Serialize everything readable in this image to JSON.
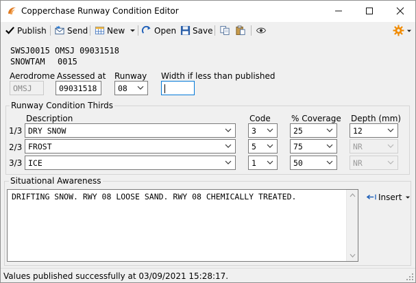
{
  "window": {
    "title": "Copperchase Runway Condition Editor",
    "controls": {
      "minimize": "—",
      "maximize": "☐",
      "close": "✕"
    }
  },
  "toolbar": {
    "publish_label": "Publish",
    "send_label": "Send",
    "new_label": "New",
    "open_label": "Open",
    "save_label": "Save"
  },
  "header": {
    "line1": "SWSJ0015 OMSJ 09031518",
    "line2_label": "SNOWTAM",
    "line2_value": "0015"
  },
  "fields": {
    "aerodrome_label": "Aerodrome",
    "aerodrome_value": "OMSJ",
    "assessed_label": "Assessed at",
    "assessed_value": "09031518",
    "runway_label": "Runway",
    "runway_value": "08",
    "width_label": "Width if less than published",
    "width_value": ""
  },
  "thirds": {
    "group_title": "Runway Condition Thirds",
    "col_description": "Description",
    "col_code": "Code",
    "col_coverage": "% Coverage",
    "col_depth": "Depth (mm)",
    "rows": [
      {
        "label": "1/3",
        "description": "DRY SNOW",
        "code": "3",
        "coverage": "25",
        "depth": "12"
      },
      {
        "label": "2/3",
        "description": "FROST",
        "code": "5",
        "coverage": "75",
        "depth": "NR"
      },
      {
        "label": "3/3",
        "description": "ICE",
        "code": "1",
        "coverage": "50",
        "depth": "NR"
      }
    ]
  },
  "situational": {
    "group_title": "Situational Awareness",
    "text": "DRIFTING SNOW. RWY 08 LOOSE SAND. RWY 08 CHEMICALLY TREATED.",
    "insert_label": "Insert"
  },
  "status": {
    "text": "Values published successfully at 03/09/2021 15:28:17."
  },
  "colors": {
    "accent": "#0078d7",
    "gear": "#f08a00",
    "logo": "#e07a20"
  }
}
